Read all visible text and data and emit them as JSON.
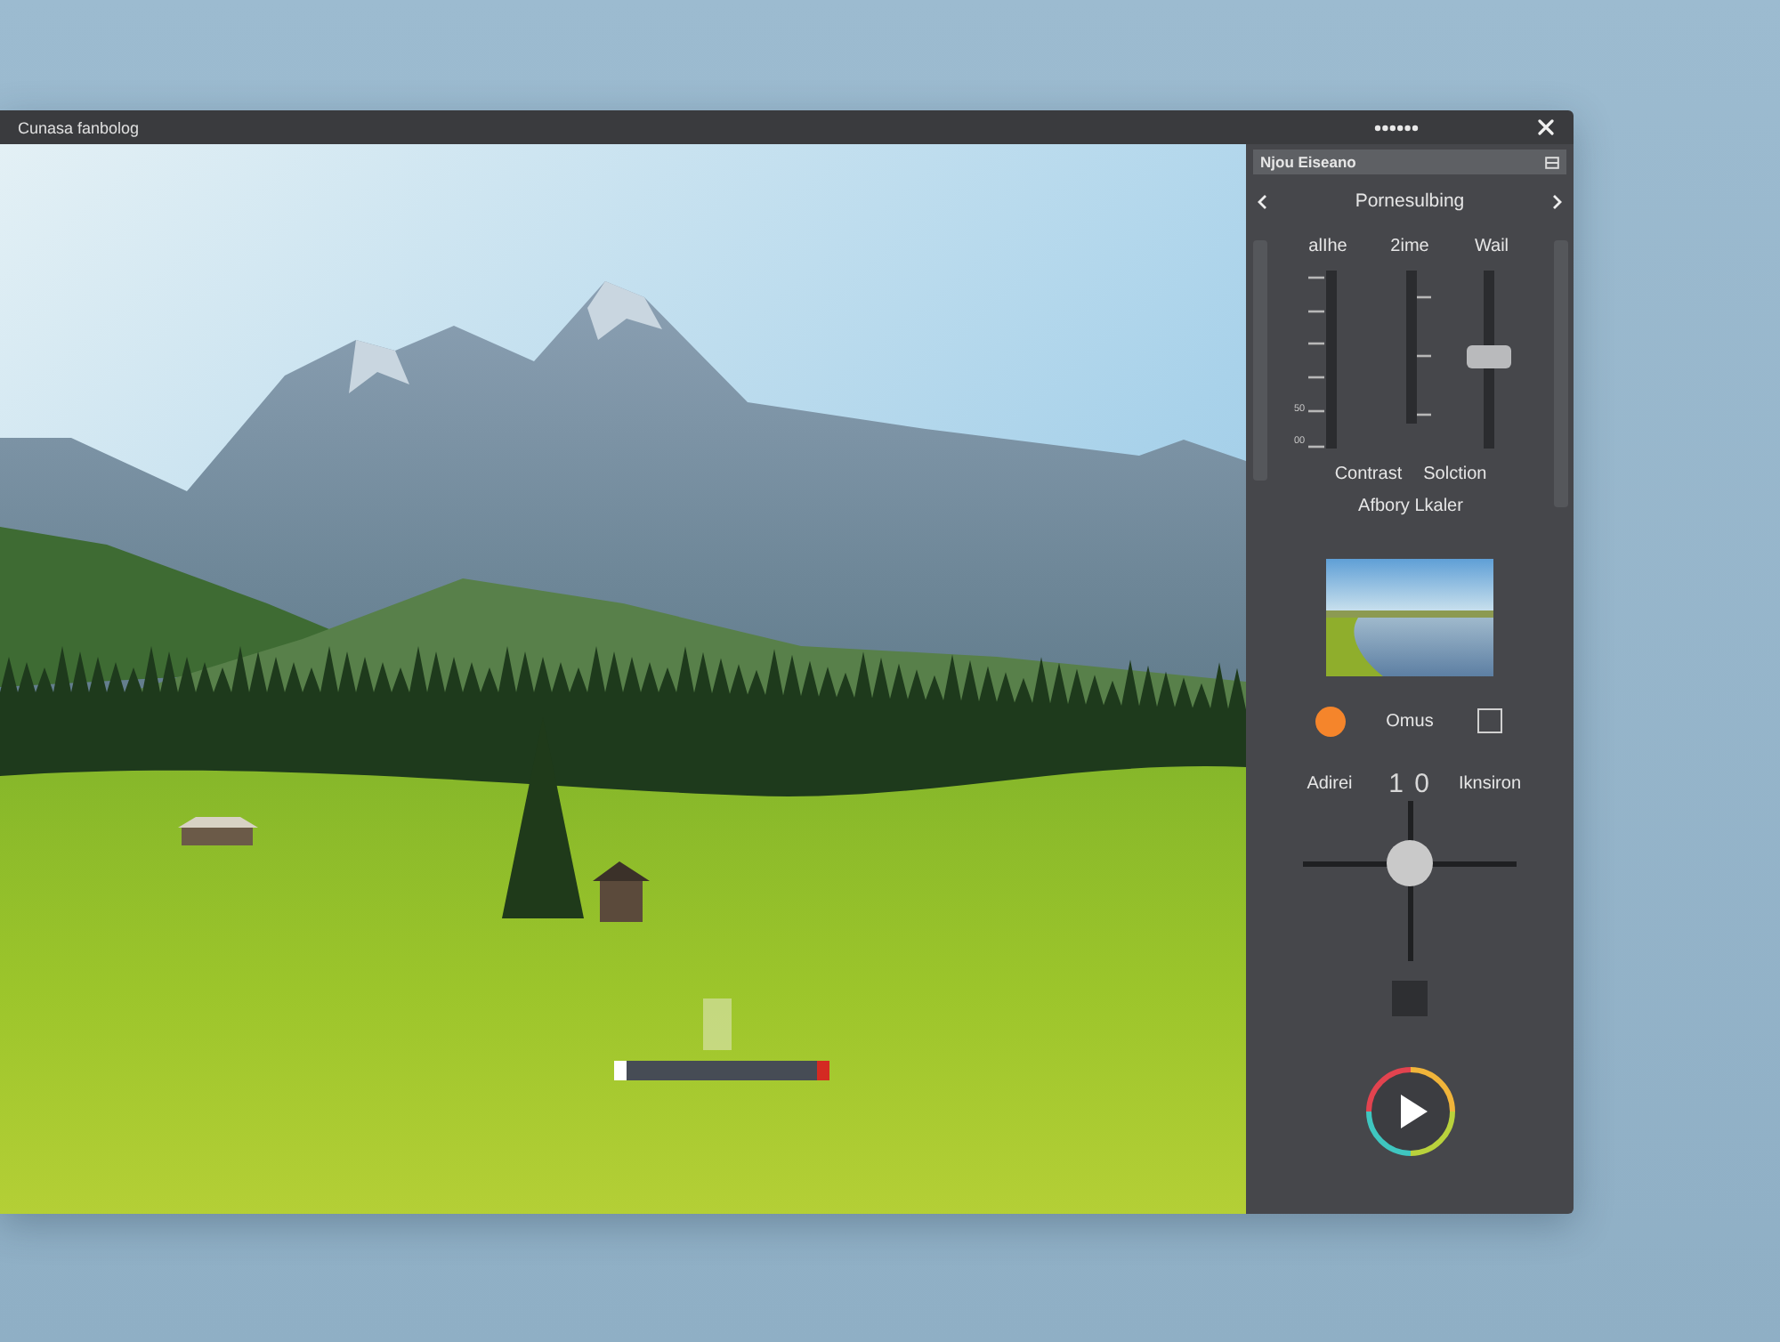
{
  "window": {
    "title": "Cunasa fanbolog"
  },
  "player": {
    "progress": {
      "level": 0.06
    }
  },
  "panel": {
    "header": "Njou Eiseano",
    "title": "Pornesulbing",
    "sliders": [
      {
        "kind": "scale-left",
        "label": "alIhe",
        "tick_labels": [
          "50",
          "00"
        ]
      },
      {
        "kind": "scale-right",
        "label": "2ime"
      },
      {
        "kind": "handle",
        "label": "Wail",
        "level": 0.52
      }
    ],
    "captions": [
      "Contrast",
      "Solction"
    ],
    "subcaption": "Afbory Lkaler",
    "option": {
      "label": "Omus",
      "checked": false
    },
    "adjust": {
      "left_label": "Adirei",
      "value": "1 0",
      "right_label": "Iknsiron"
    }
  }
}
